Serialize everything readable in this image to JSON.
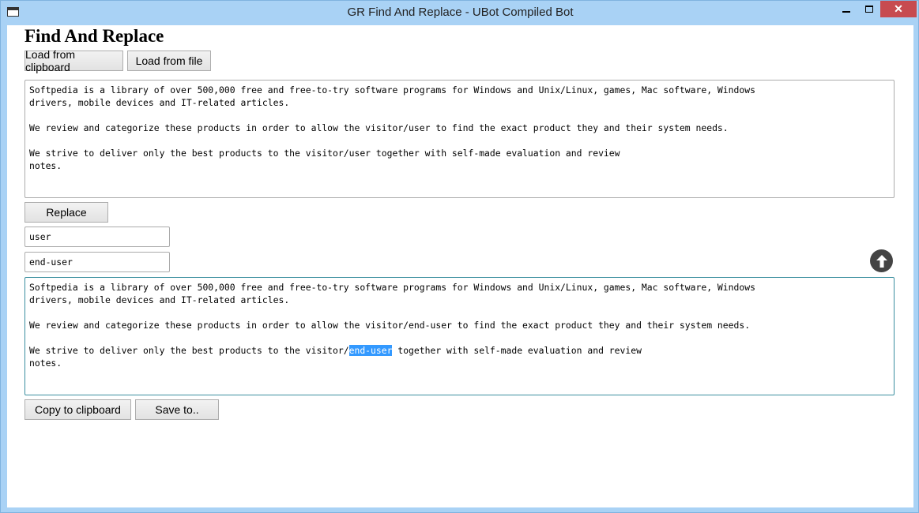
{
  "window": {
    "title": "GR Find And Replace - UBot Compiled Bot",
    "close_glyph": "✕"
  },
  "main": {
    "heading": "Find And Replace",
    "load_clipboard_label": "Load from clipboard",
    "load_file_label": "Load from file",
    "input_text": {
      "p1l1": "Softpedia is a library of over 500,000 free and free-to-try software programs for Windows and Unix/Linux, games, Mac software, Windows",
      "p1l2": "drivers, mobile devices and IT-related articles.",
      "p2": "We review and categorize these products in order to allow the visitor/user to find the exact product they and their system needs.",
      "p3l1": "We strive to deliver only the best products to the visitor/user together with self-made evaluation and review",
      "p3l2": "notes."
    },
    "replace_label": "Replace",
    "find_value": "user",
    "replace_value": "end-user",
    "output_text": {
      "p1l1": "Softpedia is a library of over 500,000 free and free-to-try software programs for Windows and Unix/Linux, games, Mac software, Windows",
      "p1l2": "drivers, mobile devices and IT-related articles.",
      "p2": "We review and categorize these products in order to allow the visitor/end-user to find the exact product they and their system needs.",
      "p3l1_before": "We strive to deliver only the best products to the visitor/",
      "p3l1_selected": "end-user",
      "p3l1_after": " together with self-made evaluation and review",
      "p3l2": "notes."
    },
    "copy_label": "Copy to clipboard",
    "save_label": "Save to.."
  },
  "colors": {
    "selection": "#3399ff",
    "close_button": "#c74b50",
    "focus_border": "#3b8f9f"
  }
}
